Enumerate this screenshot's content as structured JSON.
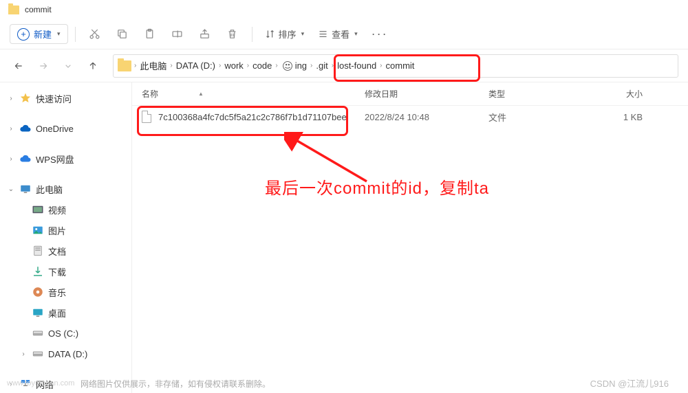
{
  "title": "commit",
  "toolbar": {
    "new_label": "新建",
    "sort_label": "排序",
    "view_label": "查看"
  },
  "breadcrumb": {
    "items": [
      "此电脑",
      "DATA (D:)",
      "work",
      "code",
      "ing",
      ".git",
      "lost-found",
      "commit"
    ]
  },
  "columns": {
    "name": "名称",
    "date": "修改日期",
    "type": "类型",
    "size": "大小"
  },
  "files": [
    {
      "name": "7c100368a4fc7dc5f5a21c2c786f7b1d71107bee",
      "date": "2022/8/24 10:48",
      "type": "文件",
      "size": "1 KB"
    }
  ],
  "sidebar": {
    "quick": "快速访问",
    "onedrive": "OneDrive",
    "wps": "WPS网盘",
    "pc": "此电脑",
    "pc_children": [
      "视频",
      "图片",
      "文档",
      "下载",
      "音乐",
      "桌面",
      "OS (C:)",
      "DATA (D:)"
    ],
    "network": "网络"
  },
  "annotation": {
    "text": "最后一次commit的id，复制ta"
  },
  "watermark": {
    "left": "www.toymoban.com",
    "mid": "网络图片仅供展示，非存储，如有侵权请联系删除。",
    "right": "CSDN @江流儿916"
  }
}
